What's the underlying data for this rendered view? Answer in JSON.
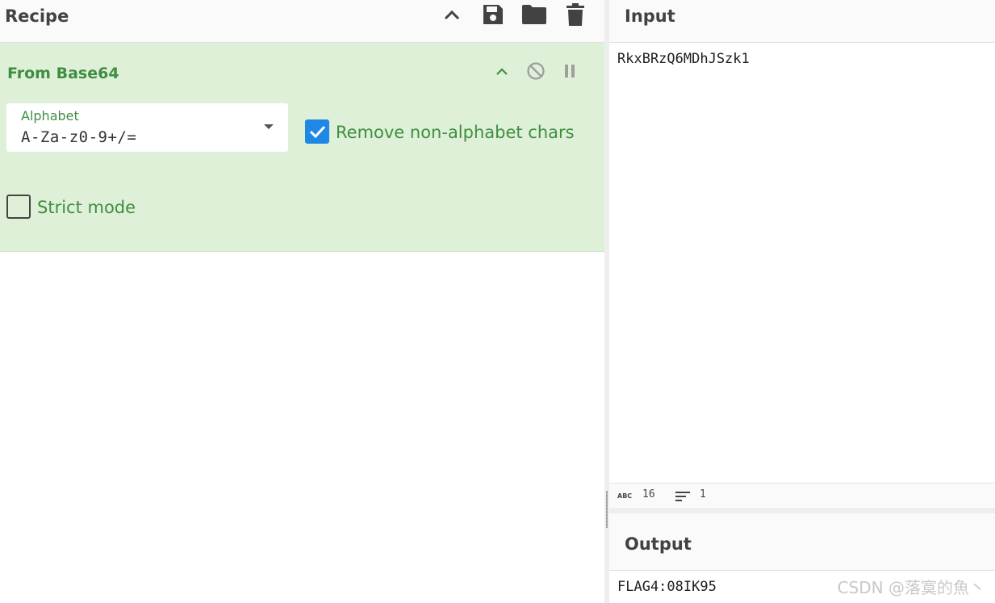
{
  "recipe": {
    "title": "Recipe",
    "toolbar_icons": [
      "chevron-up-icon",
      "save-icon",
      "folder-icon",
      "trash-icon"
    ],
    "operation": {
      "name": "From Base64",
      "alphabet_label": "Alphabet",
      "alphabet_value": "A-Za-z0-9+/=",
      "remove_nonalpha_label": "Remove non-alphabet chars",
      "remove_nonalpha_checked": true,
      "strict_mode_label": "Strict mode",
      "strict_mode_checked": false
    }
  },
  "input": {
    "title": "Input",
    "text": "RkxBRzQ6MDhJSzk1",
    "stats": {
      "length": "16",
      "lines": "1"
    }
  },
  "output": {
    "title": "Output",
    "text": "FLAG4:08IK95"
  },
  "watermark": "CSDN @落寞的魚丶",
  "colors": {
    "op_bg": "#dff0d8",
    "op_text": "#3e8e41",
    "checkbox": "#1e88e5"
  }
}
